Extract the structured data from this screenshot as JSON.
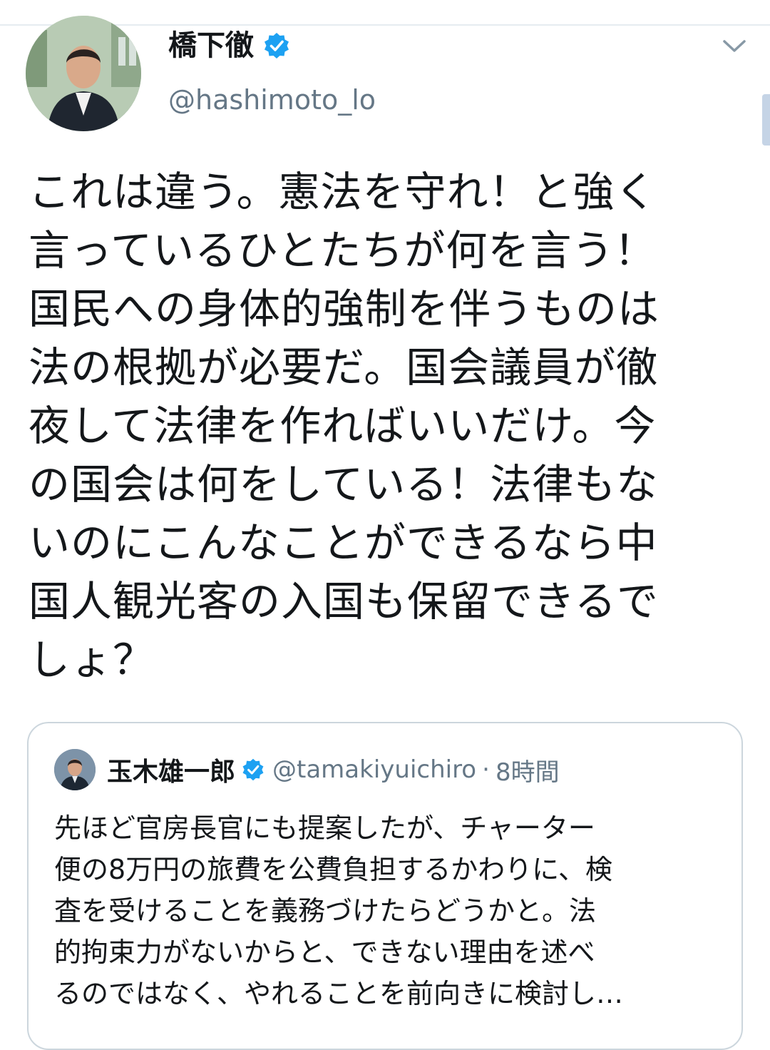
{
  "tweet": {
    "author": {
      "display_name": "橋下徹",
      "handle": "@hashimoto_lo",
      "verified": true,
      "avatar_icon": "profile-photo"
    },
    "menu_icon": "chevron-down-icon",
    "text": "これは違う。憲法を守れ！と強く\n言っているひとたちが何を言う！\n国民への身体的強制を伴うものは\n法の根拠が必要だ。国会議員が徹\n夜して法律を作ればいいだけ。今\nの国会は何をしている！法律もな\nいのにこんなことができるなら中\n国人観光客の入国も保留できるで\nしょ？"
  },
  "quoted_tweet": {
    "author": {
      "display_name": "玉木雄一郎",
      "handle": "@tamakiyuichiro",
      "verified": true
    },
    "separator": "·",
    "time": "8時間",
    "text": "先ほど官房長官にも提案したが、チャーター\n便の8万円の旅費を公費負担するかわりに、検\n査を受けることを義務づけたらどうかと。法\n的拘束力がないからと、できない理由を述べ\nるのではなく、やれることを前向きに検討し…"
  },
  "colors": {
    "verified_blue": "#1da1f2",
    "secondary_text": "#657786",
    "border": "#ccd6dd",
    "primary_text": "#14171a"
  }
}
